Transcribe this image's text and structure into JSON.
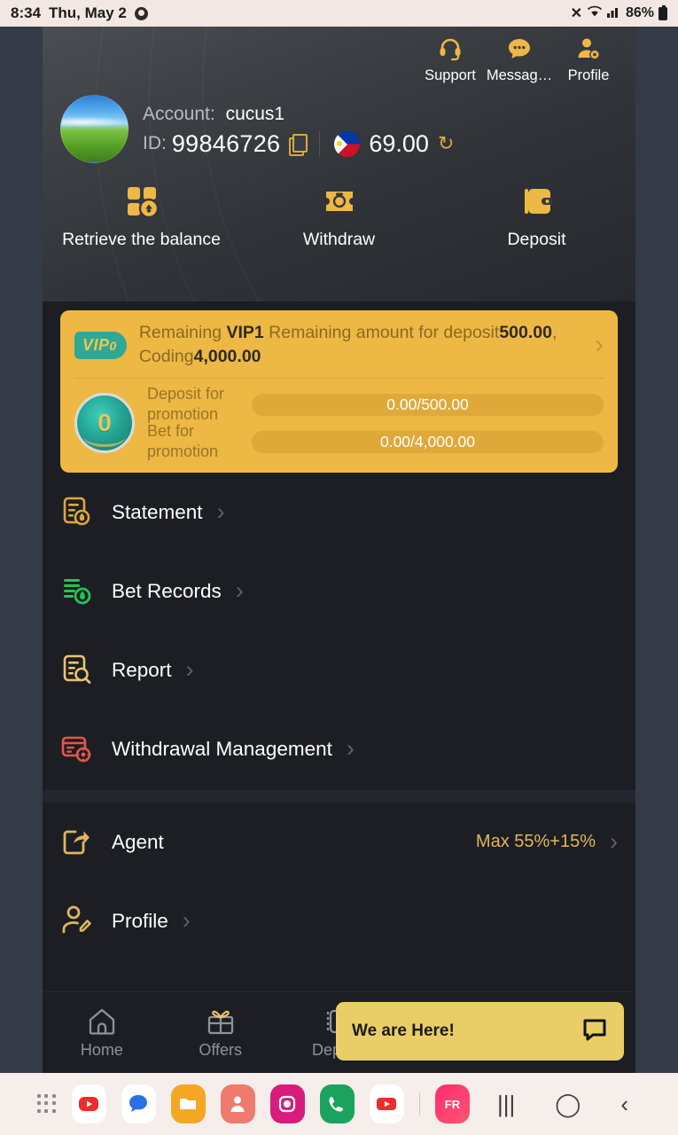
{
  "statusbar": {
    "time": "8:34",
    "date": "Thu, May 2",
    "chrome_icon": "chrome-icon",
    "mute_icon": "✕",
    "wifi_icon": "◢",
    "signal_icon": "▂▄▆",
    "battery_text": "86%"
  },
  "header": {
    "top_icons": [
      {
        "label": "Support",
        "icon": "headset-icon",
        "glyph": "☎"
      },
      {
        "label": "Messag…",
        "icon": "message-icon",
        "glyph": "●●●"
      },
      {
        "label": "Profile",
        "icon": "profile-gear-icon",
        "glyph": "☺"
      }
    ],
    "account_label": "Account:",
    "account_name": "cucus1",
    "id_label": "ID:",
    "id_value": "99846726",
    "copy_icon": "copy-icon",
    "currency_flag": "philippines-flag-icon",
    "balance": "69.00",
    "refresh_icon": "↻",
    "quick_actions": [
      {
        "label": "Retrieve the balance",
        "icon": "retrieve-balance-icon"
      },
      {
        "label": "Withdraw",
        "icon": "withdraw-icon"
      },
      {
        "label": "Deposit",
        "icon": "deposit-wallet-icon"
      }
    ]
  },
  "vip_card": {
    "badge": "VIP",
    "badge_level": "0",
    "message_prefix": "Remaining ",
    "message_tier": "VIP1",
    "message_mid": " Remaining amount for deposit",
    "deposit_amount": "500.00",
    "message_coding": ", Coding",
    "coding_amount": "4,000.00",
    "chevron": "›",
    "medal_number": "0",
    "progress": [
      {
        "label": "Deposit for promotion",
        "value": "0.00/500.00",
        "percent": 0
      },
      {
        "label": "Bet for promotion",
        "value": "0.00/4,000.00",
        "percent": 0
      }
    ]
  },
  "menu": {
    "group_one": [
      {
        "label": "Statement",
        "icon": "statement-icon",
        "color": "#e0a732",
        "extra": ""
      },
      {
        "label": "Bet Records",
        "icon": "bet-records-icon",
        "color": "#23c552",
        "extra": ""
      },
      {
        "label": "Report",
        "icon": "report-icon",
        "color": "#e8c46a",
        "extra": ""
      },
      {
        "label": "Withdrawal Management",
        "icon": "withdrawal-management-icon",
        "color": "#e2574c",
        "extra": ""
      }
    ],
    "group_two": [
      {
        "label": "Agent",
        "icon": "agent-share-icon",
        "color": "#e2b55c",
        "extra": "Max 55%+15%"
      },
      {
        "label": "Profile",
        "icon": "profile-edit-icon",
        "color": "#e2b55c",
        "extra": ""
      }
    ],
    "chevron": "›"
  },
  "bottom_nav": [
    {
      "label": "Home",
      "icon": "home-icon",
      "active": false
    },
    {
      "label": "Offers",
      "icon": "gift-icon",
      "active": false
    },
    {
      "label": "Deposit",
      "icon": "wallet-icon",
      "active": false
    },
    {
      "label": "",
      "icon": "share-icon",
      "active": true
    },
    {
      "label": "",
      "icon": "account-icon",
      "active": true
    }
  ],
  "chat_widget": {
    "text": "We are Here!",
    "icon": "chat-bubble-icon"
  },
  "taskbar": {
    "apps": [
      "▶",
      "●",
      "■",
      "●",
      "●",
      "✆",
      "▶",
      "FR"
    ],
    "recents_icon": "|||",
    "home_icon": "◯",
    "back_icon": "‹"
  },
  "colors": {
    "accent_gold": "#eeb845",
    "app_bg": "#1c1e24",
    "teal": "#2fa894"
  }
}
